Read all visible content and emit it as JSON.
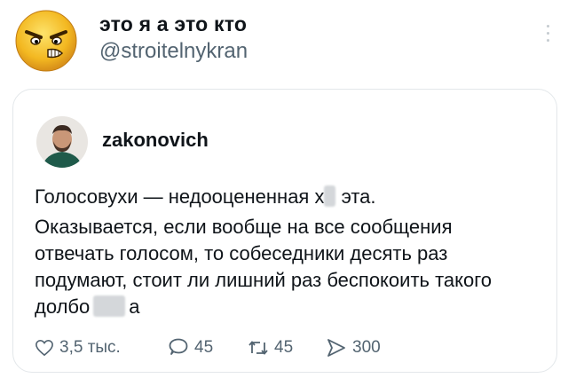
{
  "post": {
    "author_name": "это я а это кто",
    "author_handle": "@stroitelnykran",
    "avatar_icon": "angry-emoji-icon",
    "more_icon": "more-vertical-icon"
  },
  "quote": {
    "author_name": "zakonovich",
    "avatar_icon": "user-photo",
    "line1_a": "Голосовухи — недооцененная х",
    "line1_b": "эта.",
    "line2": "Оказывается, если вообще на все сообщения отвечать голосом, то собеседники десять раз подумают, стоит ли лишний раз беспокоить такого",
    "line3_a": "долбо",
    "line3_b": "а"
  },
  "actions": {
    "likes": "3,5 тыс.",
    "replies": "45",
    "reposts": "45",
    "views": "300"
  },
  "colors": {
    "text": "#0f1419",
    "secondary": "#536471",
    "border": "#e3e7ea"
  }
}
